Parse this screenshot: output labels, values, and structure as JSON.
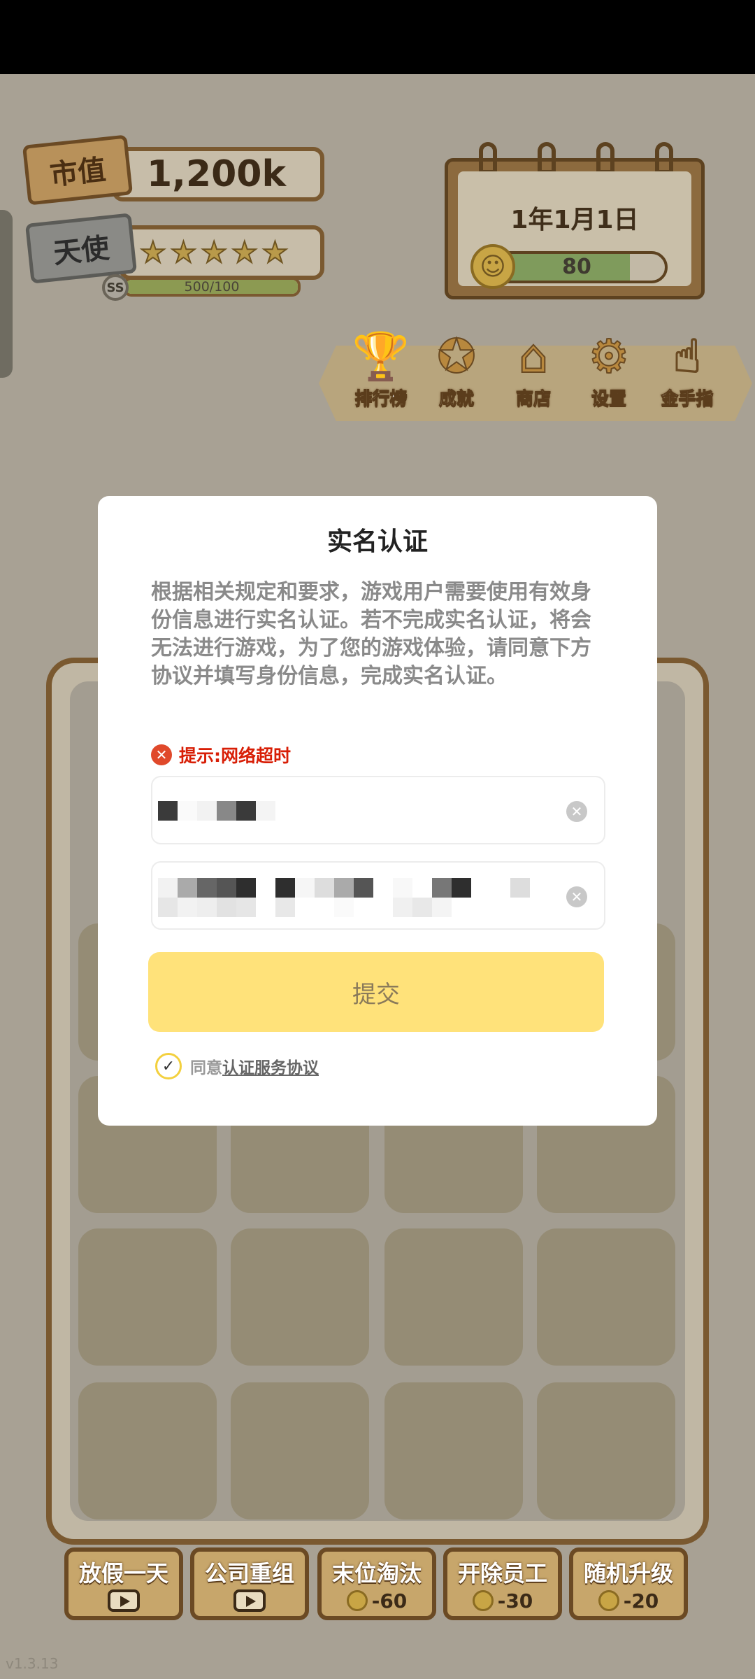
{
  "header": {
    "market_value_label": "市值",
    "market_value": "1,200k",
    "angel_label": "天使",
    "stars": 5,
    "rank_badge": "SS",
    "rank_progress_text": "500/100",
    "rank_progress_fraction": 1.0
  },
  "calendar": {
    "date": "1年1月1日",
    "mood_value": "80",
    "mood_fraction": 0.8
  },
  "menu": [
    {
      "label": "排行榜",
      "icon": "trophy-icon"
    },
    {
      "label": "成就",
      "icon": "medal-icon"
    },
    {
      "label": "商店",
      "icon": "shop-icon"
    },
    {
      "label": "设置",
      "icon": "gear-icon"
    },
    {
      "label": "金手指",
      "icon": "pointing-hand-icon"
    }
  ],
  "actions": [
    {
      "label": "放假一天",
      "cost": "",
      "cost_type": "video"
    },
    {
      "label": "公司重组",
      "cost": "",
      "cost_type": "video"
    },
    {
      "label": "末位淘汰",
      "cost": "-60",
      "cost_type": "coin"
    },
    {
      "label": "开除员工",
      "cost": "-30",
      "cost_type": "coin"
    },
    {
      "label": "随机升级",
      "cost": "-20",
      "cost_type": "coin"
    }
  ],
  "version": "v1.3.13",
  "modal": {
    "title": "实名认证",
    "description": "根据相关规定和要求，游戏用户需要使用有效身份信息进行实名认证。若不完成实名认证，将会无法进行游戏，为了您的游戏体验，请同意下方协议并填写身份信息，完成实名认证。",
    "tip": "提示:网络超时",
    "name_field_value": "",
    "id_field_value": "",
    "submit_label": "提交",
    "agree_prefix": "同意",
    "agree_link": "认证服务协议",
    "agree_checked": true
  },
  "colors": {
    "submit_button": "#ffe27a",
    "tip_red": "#d81e06",
    "checkbox_ring": "#f3d03e"
  }
}
